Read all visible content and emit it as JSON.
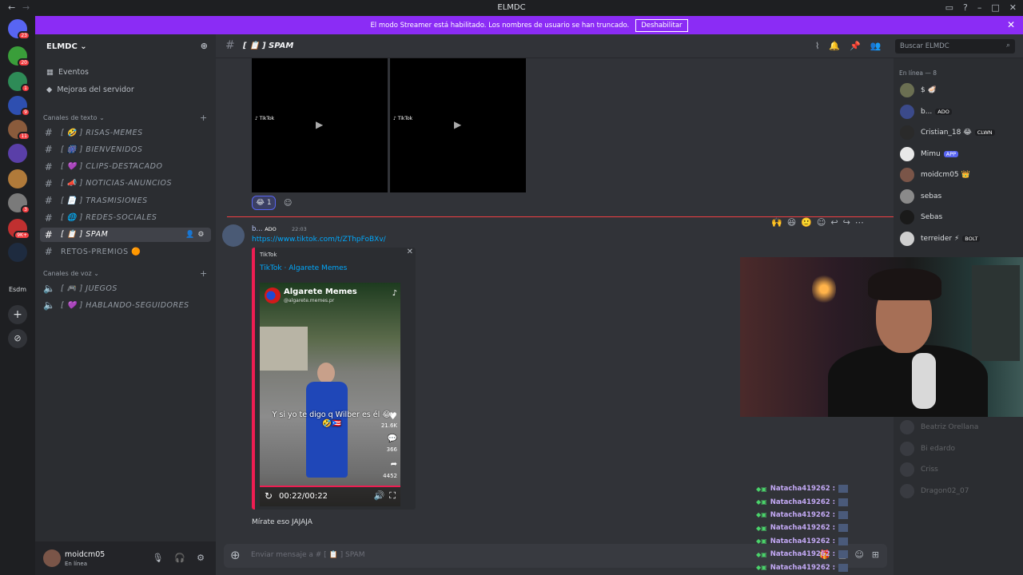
{
  "window": {
    "title": "ELMDC"
  },
  "banner": {
    "text": "El modo Streamer está habilitado. Los nombres de usuario se han truncado.",
    "button": "Deshabilitar"
  },
  "servers": [
    {
      "badge": "23",
      "color": "#5865f2"
    },
    {
      "badge": "20",
      "color": "#3a9e3a"
    },
    {
      "badge": "1",
      "color": "#2e8b57"
    },
    {
      "badge": "9",
      "color": "#2e4fb0"
    },
    {
      "badge": "11",
      "color": "#8a5b3c"
    },
    {
      "badge": "",
      "color": "#5a3fa8"
    },
    {
      "badge": "",
      "color": "#b07a3a"
    },
    {
      "badge": "3",
      "color": "#7a7a7a"
    },
    {
      "badge": "9K+",
      "color": "#c03030"
    },
    {
      "badge": "",
      "color": "#1e2b3f"
    }
  ],
  "server_label": "Esdm",
  "sidebar": {
    "server_name": "ELMDC",
    "events": "Eventos",
    "boosts": "Mejoras del servidor",
    "text_category": "Canales de texto",
    "text_channels": [
      "[ 🤣 ] RISAS-MEMES",
      "[ 🎆 ] BIENVENIDOS",
      "[ 💜 ] CLIPS-DESTACADO",
      "[ 📣 ] NOTICIAS-ANUNCIOS",
      "[ 📄 ] TRASMISIONES",
      "[ 🌐 ] REDES-SOCIALES",
      "[ 📋 ] SPAM",
      "RETOS-PREMIOS 🟠"
    ],
    "voice_category": "Canales de voz",
    "voice_channels": [
      "[ 🎮 ] JUEGOS",
      "[ 💜 ] HABLANDO-SEGUIDORES"
    ]
  },
  "user": {
    "name": "moidcm05",
    "status": "En línea"
  },
  "channel_header": {
    "name": "[ 📋 ] SPAM",
    "search_placeholder": "Buscar ELMDC"
  },
  "messages": {
    "reaction_count": "1",
    "author": "b...",
    "author_tag": "ADO",
    "time": "22:03",
    "link": "https://www.tiktok.com/t/ZThpFoBXv/",
    "embed_provider": "TikTok",
    "embed_title": "TikTok · Algarete Memes",
    "video_channel": "Algarete Memes",
    "video_handle": "@algarete.memes.pr",
    "video_caption": "Y si yo te digo q Wilber es él 😂🤣🇵🇷",
    "likes": "21.6K",
    "comments": "366",
    "shares": "4452",
    "video_time": "00:22/00:22",
    "text": "Mírate eso JAJAJA"
  },
  "composer": {
    "placeholder": "Enviar mensaje a # [ 📋 ] SPAM"
  },
  "members": {
    "header": "En línea — 8",
    "list": [
      {
        "name": "$ 🦪",
        "tag": ""
      },
      {
        "name": "b...",
        "tag": "ADO"
      },
      {
        "name": "Cristian_18 😂",
        "tag": "CLWN"
      },
      {
        "name": "Mimu",
        "tag": "APP"
      },
      {
        "name": "moidcm05 👑",
        "tag": ""
      },
      {
        "name": "sebas",
        "tag": ""
      },
      {
        "name": "Sebas",
        "tag": ""
      },
      {
        "name": "terreider ⚡",
        "tag": "BOLT"
      }
    ],
    "offline": [
      "Beatriz Orellana",
      "Bi edardo",
      "Criss",
      "Dragon02_07"
    ]
  },
  "stream_chat": [
    "Natacha419262 :",
    "Natacha419262 :",
    "Natacha419262 :",
    "Natacha419262 :",
    "Natacha419262 :",
    "Natacha419262 :",
    "Natacha419262 :"
  ]
}
